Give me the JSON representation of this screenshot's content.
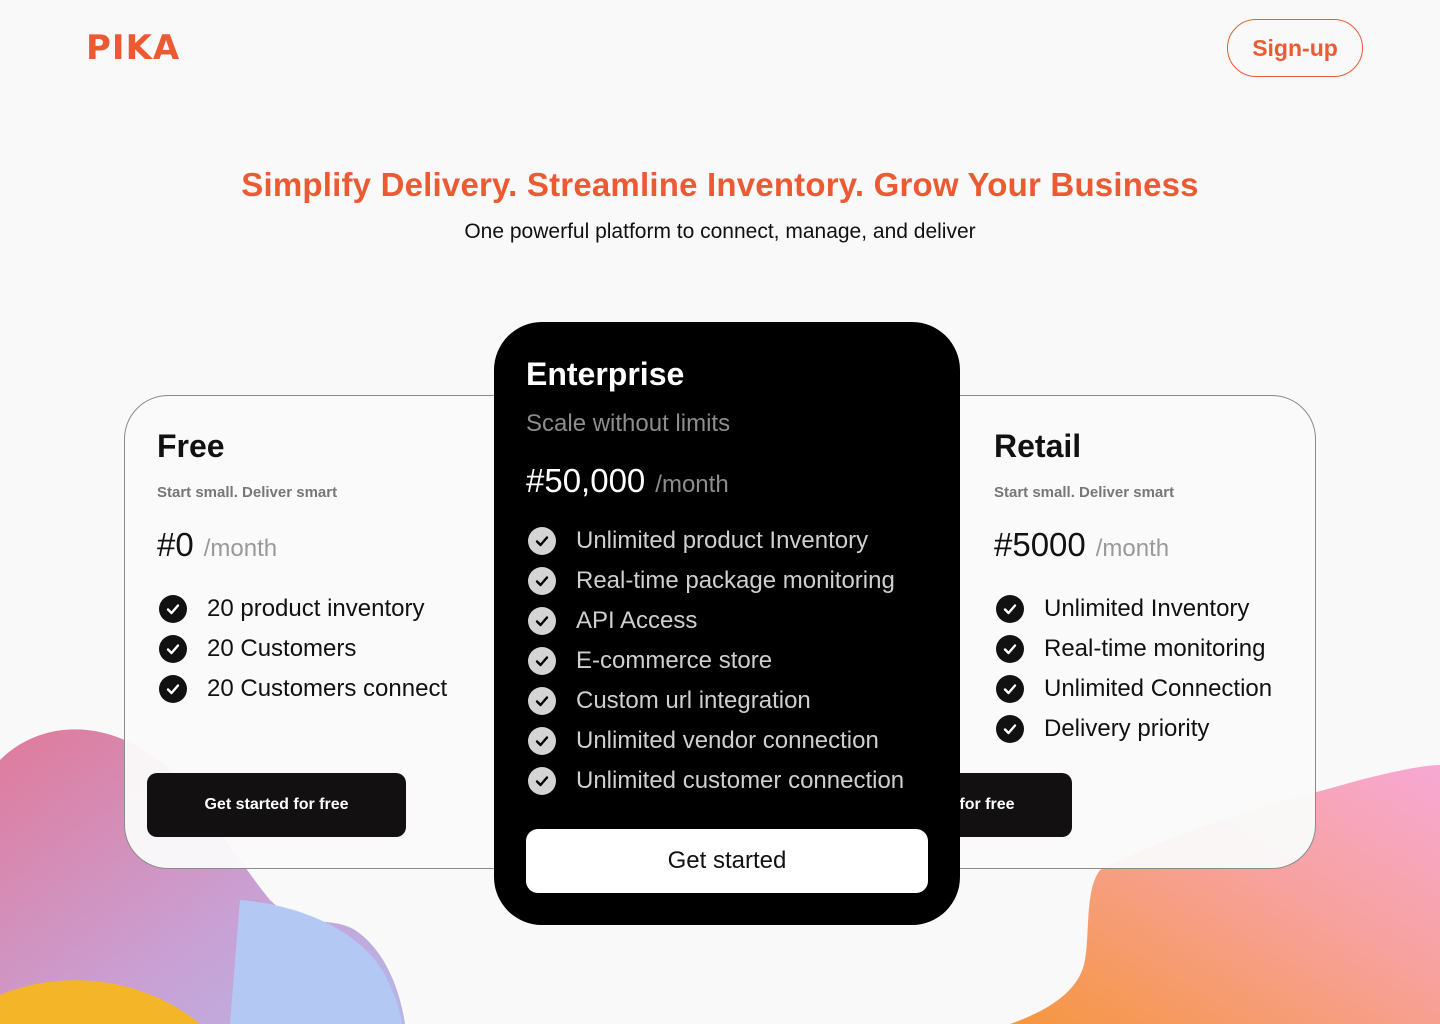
{
  "brand": {
    "logo": "PIKA",
    "accent": "#ec5a34"
  },
  "header": {
    "signup_label": "Sign-up"
  },
  "hero": {
    "title": "Simplify Delivery. Streamline Inventory. Grow Your Business",
    "subtitle": "One powerful platform to connect, manage, and deliver"
  },
  "plans": {
    "free": {
      "name": "Free",
      "tagline": "Start small. Deliver smart",
      "price": "#0",
      "period": "/month",
      "features": [
        "20 product inventory",
        "20 Customers",
        "20 Customers connect"
      ],
      "cta": "Get started for free"
    },
    "enterprise": {
      "name": "Enterprise",
      "tagline": "Scale without limits",
      "price": "#50,000",
      "period": "/month",
      "features": [
        "Unlimited product Inventory",
        "Real-time package monitoring",
        "API Access",
        "E-commerce store",
        "Custom url integration",
        "Unlimited vendor connection",
        "Unlimited customer connection"
      ],
      "cta": "Get started"
    },
    "retail": {
      "name": "Retail",
      "tagline": "Start small. Deliver smart",
      "price": "#5000",
      "period": "/month",
      "features": [
        "Unlimited Inventory",
        "Real-time monitoring",
        "Unlimited Connection",
        "Delivery priority"
      ],
      "cta": "Get started for free"
    }
  },
  "icons": {
    "feature": "check-circle-icon"
  }
}
